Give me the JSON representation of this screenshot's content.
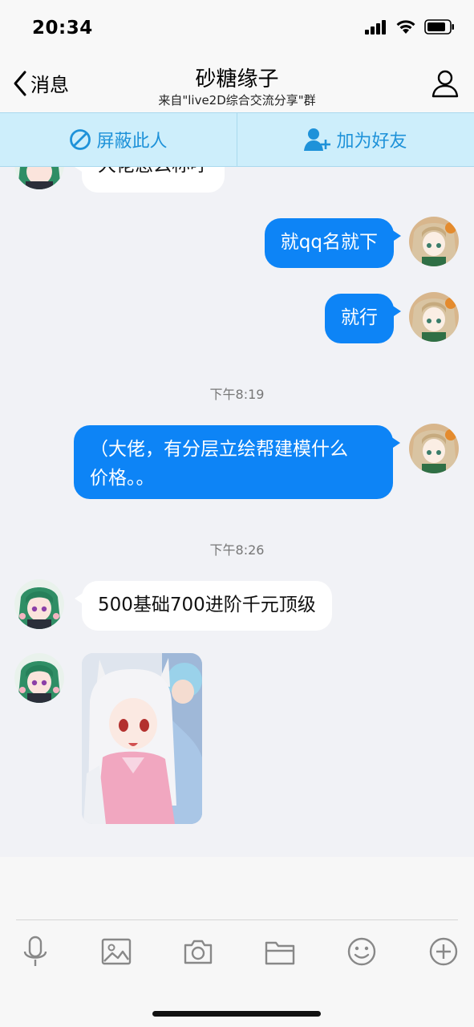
{
  "status_bar": {
    "time": "20:34"
  },
  "nav": {
    "back_label": "消息",
    "title": "砂糖缘子",
    "subtitle": "来自\"live2D综合交流分享\"群"
  },
  "actions": {
    "block_label": "屏蔽此人",
    "add_friend_label": "加为好友"
  },
  "messages": {
    "m0_partial": "大佬怎么称呼",
    "m1": "就qq名就下",
    "m2": "就行",
    "t1": "下午8:19",
    "m3_line1": "（大佬，有分层立绘帮建模什么",
    "m3_line2": "价格。。",
    "t2": "下午8:26",
    "m4": "500基础700进阶千元顶级"
  },
  "toolbar_icons": [
    "microphone-icon",
    "image-icon",
    "camera-icon",
    "folder-icon",
    "emoji-icon",
    "plus-icon"
  ],
  "colors": {
    "outgoing_bubble": "#0d84f6",
    "incoming_bubble": "#ffffff",
    "action_bar": "#cdeefb",
    "accent": "#1e92d9"
  }
}
